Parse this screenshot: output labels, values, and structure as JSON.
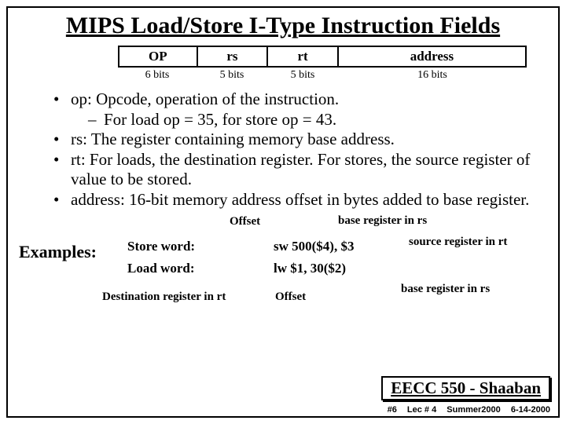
{
  "title": "MIPS Load/Store I-Type Instruction Fields",
  "fields": {
    "op": "OP",
    "rs": "rs",
    "rt": "rt",
    "addr": "address"
  },
  "bits": {
    "op": "6 bits",
    "rs": "5 bits",
    "rt": "5 bits",
    "addr": "16  bits"
  },
  "bullets": {
    "b1": "op: Opcode, operation of the instruction.",
    "b1sub": "For load op = 35,  for store op = 43.",
    "b2": "rs: The register containing memory base address.",
    "b3": "rt: For loads, the destination register.  For stores, the source register of value to be stored.",
    "b4": "address:  16-bit memory address offset in bytes added to base register."
  },
  "annot": {
    "offset": "Offset",
    "base_rs": "base register in rs",
    "src_rt": "source register in rt",
    "dest_rt": "Destination register in rt"
  },
  "examples": {
    "label": "Examples:",
    "sw_label": "Store word:",
    "sw_code": "sw  500($4), $3",
    "lw_label": "Load word:",
    "lw_code": "lw $1, 30($2)"
  },
  "footer": {
    "course": "EECC 550 - Shaaban",
    "slide": "#6",
    "lec": "Lec # 4",
    "term": "Summer2000",
    "date": "6-14-2000"
  }
}
